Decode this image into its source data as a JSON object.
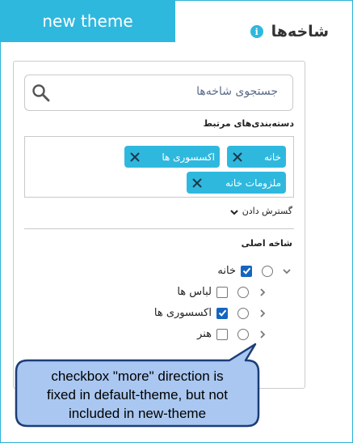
{
  "theme_tab": {
    "label": "new theme"
  },
  "header": {
    "title": "شاخه‌ها",
    "info_glyph": "i"
  },
  "search": {
    "placeholder": "جستجوی شاخه‌ها"
  },
  "related": {
    "label": "دسته‌بندی‌های مرتبط",
    "chips": [
      {
        "label": "خانه"
      },
      {
        "label": "اکسسوری ها"
      },
      {
        "label": "ملزومات خانه"
      }
    ]
  },
  "expand": {
    "label": "گسترش دادن"
  },
  "main": {
    "label": "شاخه اصلی",
    "tree": [
      {
        "label": "خانه",
        "checked": true,
        "chevron": "down"
      },
      {
        "label": "لباس ها",
        "checked": false,
        "chevron": "right"
      },
      {
        "label": "اکسسوری ها",
        "checked": true,
        "chevron": "right"
      },
      {
        "label": "هنر",
        "checked": false,
        "chevron": "right"
      }
    ]
  },
  "callout": {
    "line1": "checkbox \"more\" direction is",
    "line2": "fixed in default-theme, but not",
    "line3": "included in new-theme"
  },
  "colors": {
    "accent": "#2fb8de",
    "check": "#1565c0",
    "callout_fill": "#a9c7f0",
    "callout_border": "#1c3d78"
  }
}
